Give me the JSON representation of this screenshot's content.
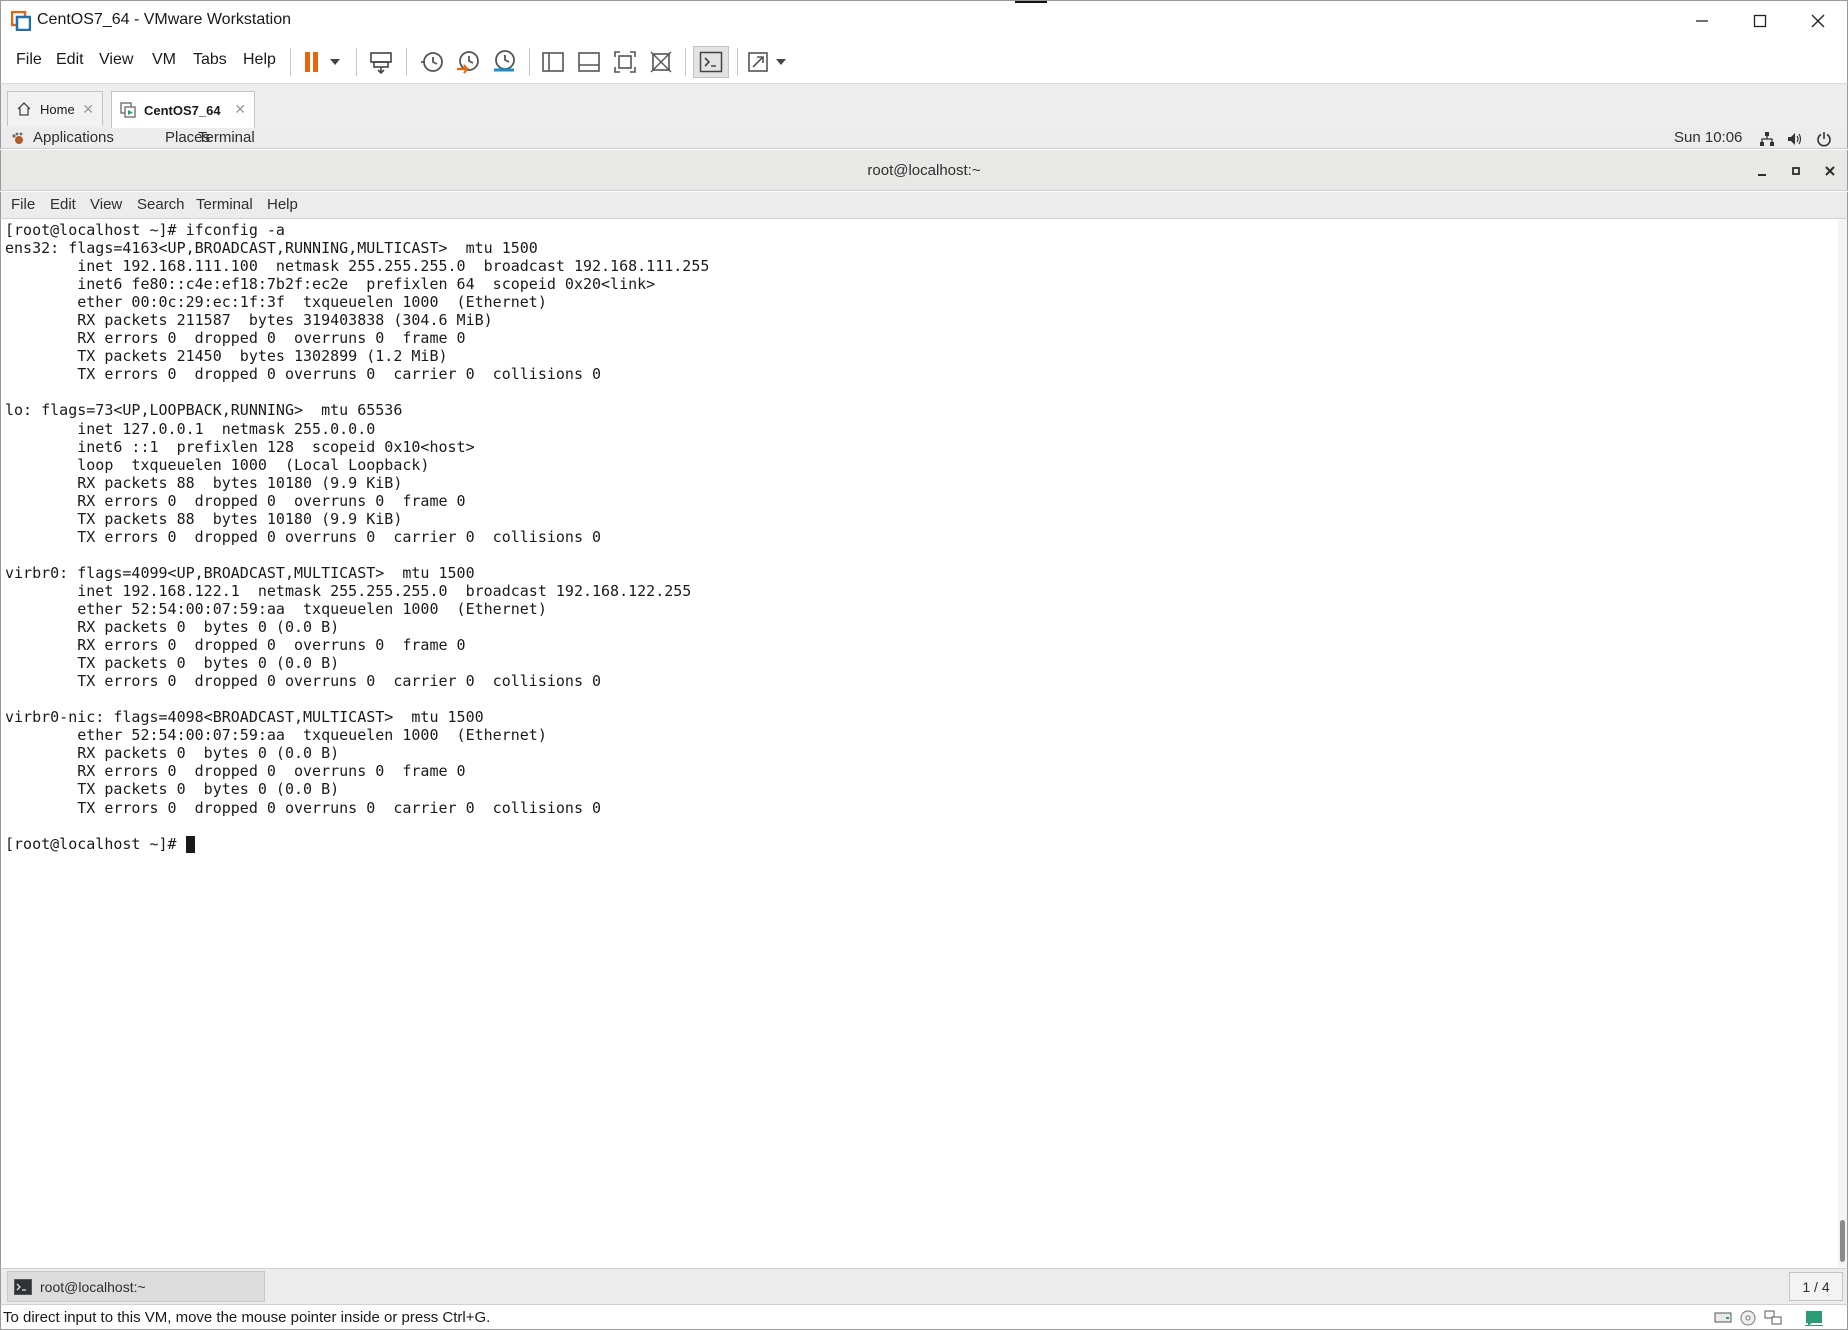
{
  "window": {
    "title": "CentOS7_64 - VMware Workstation"
  },
  "menubar": {
    "items": [
      "File",
      "Edit",
      "View",
      "VM",
      "Tabs",
      "Help"
    ]
  },
  "tabs": [
    {
      "label": "Home",
      "active": false
    },
    {
      "label": "CentOS7_64",
      "active": true
    }
  ],
  "gnome": {
    "applications": "Applications",
    "places": "Places",
    "terminal": "Terminal",
    "clock": "Sun 10:06"
  },
  "terminal": {
    "title": "root@localhost:~",
    "menu": [
      "File",
      "Edit",
      "View",
      "Search",
      "Terminal",
      "Help"
    ],
    "lines": [
      "[root@localhost ~]# ifconfig -a",
      "ens32: flags=4163<UP,BROADCAST,RUNNING,MULTICAST>  mtu 1500",
      "        inet 192.168.111.100  netmask 255.255.255.0  broadcast 192.168.111.255",
      "        inet6 fe80::c4e:ef18:7b2f:ec2e  prefixlen 64  scopeid 0x20<link>",
      "        ether 00:0c:29:ec:1f:3f  txqueuelen 1000  (Ethernet)",
      "        RX packets 211587  bytes 319403838 (304.6 MiB)",
      "        RX errors 0  dropped 0  overruns 0  frame 0",
      "        TX packets 21450  bytes 1302899 (1.2 MiB)",
      "        TX errors 0  dropped 0 overruns 0  carrier 0  collisions 0",
      "",
      "lo: flags=73<UP,LOOPBACK,RUNNING>  mtu 65536",
      "        inet 127.0.0.1  netmask 255.0.0.0",
      "        inet6 ::1  prefixlen 128  scopeid 0x10<host>",
      "        loop  txqueuelen 1000  (Local Loopback)",
      "        RX packets 88  bytes 10180 (9.9 KiB)",
      "        RX errors 0  dropped 0  overruns 0  frame 0",
      "        TX packets 88  bytes 10180 (9.9 KiB)",
      "        TX errors 0  dropped 0 overruns 0  carrier 0  collisions 0",
      "",
      "virbr0: flags=4099<UP,BROADCAST,MULTICAST>  mtu 1500",
      "        inet 192.168.122.1  netmask 255.255.255.0  broadcast 192.168.122.255",
      "        ether 52:54:00:07:59:aa  txqueuelen 1000  (Ethernet)",
      "        RX packets 0  bytes 0 (0.0 B)",
      "        RX errors 0  dropped 0  overruns 0  frame 0",
      "        TX packets 0  bytes 0 (0.0 B)",
      "        TX errors 0  dropped 0 overruns 0  carrier 0  collisions 0",
      "",
      "virbr0-nic: flags=4098<BROADCAST,MULTICAST>  mtu 1500",
      "        ether 52:54:00:07:59:aa  txqueuelen 1000  (Ethernet)",
      "        RX packets 0  bytes 0 (0.0 B)",
      "        RX errors 0  dropped 0  overruns 0  frame 0",
      "        TX packets 0  bytes 0 (0.0 B)",
      "        TX errors 0  dropped 0 overruns 0  carrier 0  collisions 0",
      ""
    ],
    "prompt": "[root@localhost ~]# "
  },
  "taskbar": {
    "item": "root@localhost:~",
    "workspace": "1 / 4"
  },
  "statusbar": {
    "text": "To direct input to this VM, move the mouse pointer inside or press Ctrl+G."
  },
  "colors": {
    "pause_orange": "#e8650f",
    "snapshot_orange": "#e8650f",
    "snapshot_blue": "#1e8fc6",
    "vmware_orange": "#e8650f",
    "status_green": "#2a9d74"
  }
}
